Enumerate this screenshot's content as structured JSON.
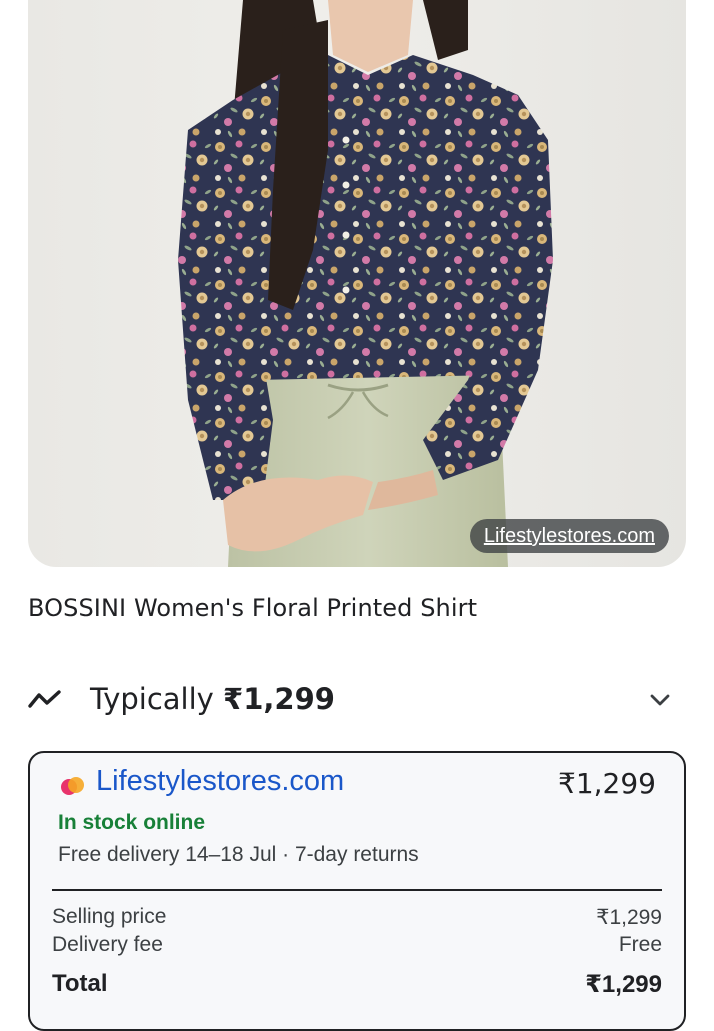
{
  "product": {
    "image_alt": "Woman wearing navy floral printed long-sleeve shirt with sage green trousers",
    "source_chip": "Lifestylestores.com",
    "title": "BOSSINI Women's Floral Printed Shirt"
  },
  "pricing": {
    "typical_label": "Typically",
    "typical_price": "₹1,299",
    "trend_icon": "trending-icon",
    "expand_icon": "chevron-down-icon"
  },
  "offer": {
    "store_name": "Lifestylestores.com",
    "price": "₹1,299",
    "stock_status": "In stock online",
    "delivery": "Free delivery 14–18 Jul · 7-day returns",
    "breakdown": [
      {
        "label": "Selling price",
        "value": "₹1,299"
      },
      {
        "label": "Delivery fee",
        "value": "Free"
      }
    ],
    "total": {
      "label": "Total",
      "value": "₹1,299"
    }
  },
  "colors": {
    "store_link": "#1a57c9",
    "in_stock": "#188038",
    "card_bg": "#f7f8fa",
    "shirt_navy": "#2f3552",
    "trouser_sage": "#c9ceb3"
  }
}
